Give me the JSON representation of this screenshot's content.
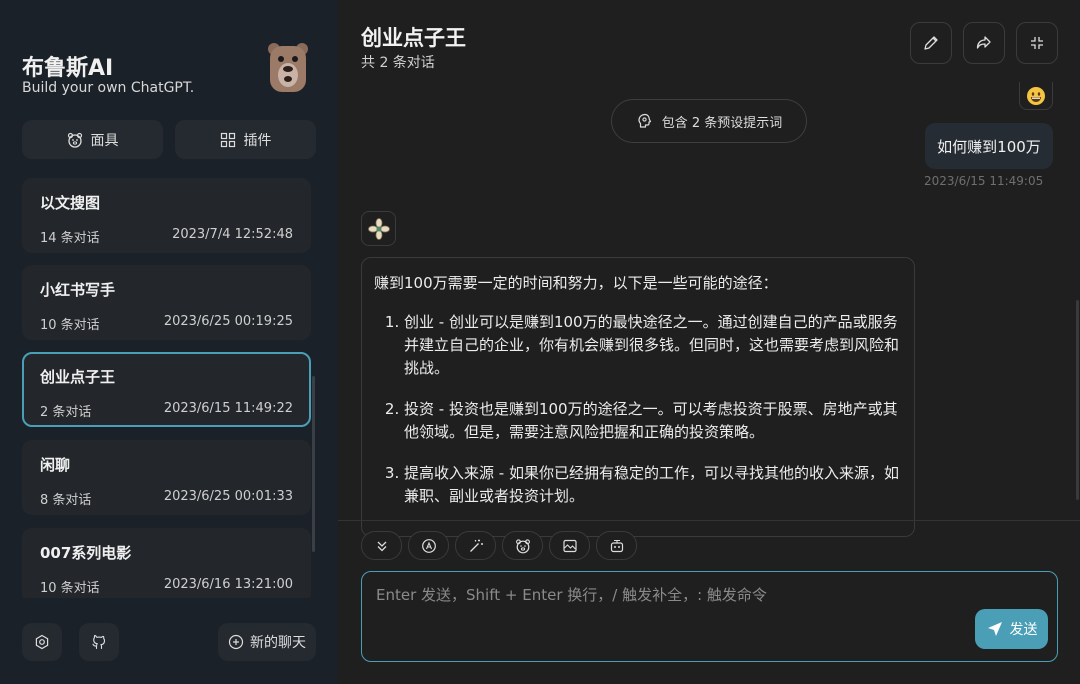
{
  "sidebar": {
    "title": "布鲁斯AI",
    "subtitle": "Build your own ChatGPT.",
    "mask_label": "面具",
    "plugin_label": "插件",
    "new_chat_label": "新的聊天",
    "sessions": [
      {
        "title": "以文搜图",
        "count": "14 条对话",
        "time": "2023/7/4 12:52:48"
      },
      {
        "title": "小红书写手",
        "count": "10 条对话",
        "time": "2023/6/25 00:19:25"
      },
      {
        "title": "创业点子王",
        "count": "2 条对话",
        "time": "2023/6/15 11:49:22"
      },
      {
        "title": "闲聊",
        "count": "8 条对话",
        "time": "2023/6/25 00:01:33"
      },
      {
        "title": "007系列电影",
        "count": "10 条对话",
        "time": "2023/6/16 13:21:00"
      }
    ]
  },
  "chat": {
    "title": "创业点子王",
    "count": "共 2 条对话",
    "prompt_pill": "包含 2 条预设提示词",
    "user_message": "如何赚到100万",
    "user_time": "2023/6/15 11:49:05",
    "bot_intro": "赚到100万需要一定的时间和努力，以下是一些可能的途径：",
    "bot_items": [
      "创业 - 创业可以是赚到100万的最快途径之一。通过创建自己的产品或服务并建立自己的企业，你有机会赚到很多钱。但同时，这也需要考虑到风险和挑战。",
      "投资 - 投资也是赚到100万的途径之一。可以考虑投资于股票、房地产或其他领域。但是，需要注意风险把握和正确的投资策略。",
      "提高收入来源 - 如果你已经拥有稳定的工作，可以寻找其他的收入来源，如兼职、副业或者投资计划。"
    ]
  },
  "input": {
    "placeholder": "Enter 发送，Shift + Enter 换行，/ 触发补全，: 触发命令",
    "send_label": "发送"
  },
  "colors": {
    "accent": "#4a9fb6",
    "sidebar_bg": "#1b2128",
    "main_bg": "#1f1f1f"
  }
}
